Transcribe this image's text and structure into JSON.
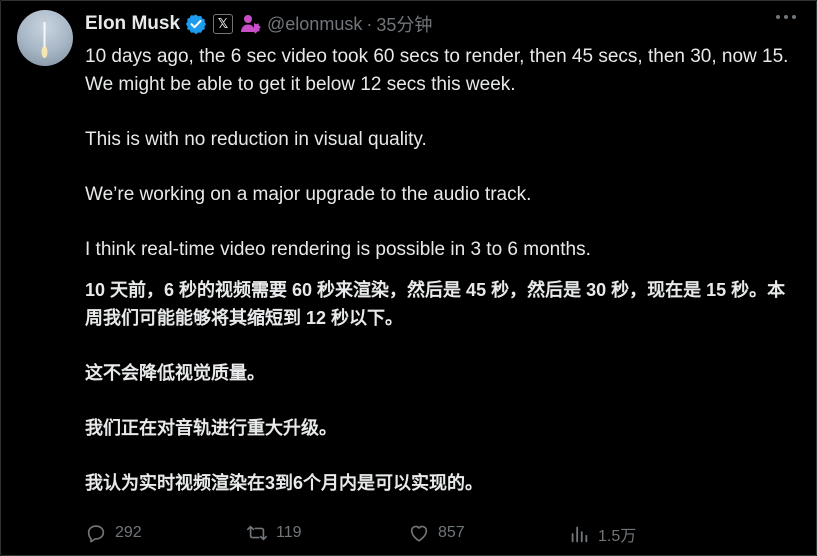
{
  "author": {
    "name": "Elon Musk",
    "handle": "@elonmusk",
    "separator": "·",
    "time": "35分钟",
    "badge_x": "𝕏"
  },
  "icons": {
    "verified": "verified-badge-icon",
    "x_badge": "x-logo-icon",
    "affiliate": "person-affiliate-icon",
    "more": "more-dots-icon",
    "reply": "reply-icon",
    "retweet": "retweet-icon",
    "like": "heart-icon",
    "views": "views-bar-icon"
  },
  "colors": {
    "background": "#000000",
    "text": "#e7e9ea",
    "muted": "#71767b",
    "verified": "#1d9bf0",
    "affiliate": "#c94fc9"
  },
  "tweet": {
    "en": [
      "10 days ago, the 6 sec video took 60 secs to render, then 45 secs, then 30, now 15. We might be able to get it below 12 secs this week.",
      "This is with no reduction in visual quality.",
      "We’re working on a major upgrade to the audio track.",
      "I think real-time video rendering is possible in 3 to 6 months."
    ],
    "zh": [
      "10 天前，6 秒的视频需要 60 秒来渲染，然后是 45 秒，然后是 30 秒，现在是 15 秒。本周我们可能能够将其缩短到 12 秒以下。",
      "这不会降低视觉质量。",
      "我们正在对音轨进行重大升级。",
      "我认为实时视频渲染在3到6个月内是可以实现的。"
    ]
  },
  "metrics": {
    "replies": "292",
    "retweets": "119",
    "likes": "857",
    "views": "1.5万"
  }
}
